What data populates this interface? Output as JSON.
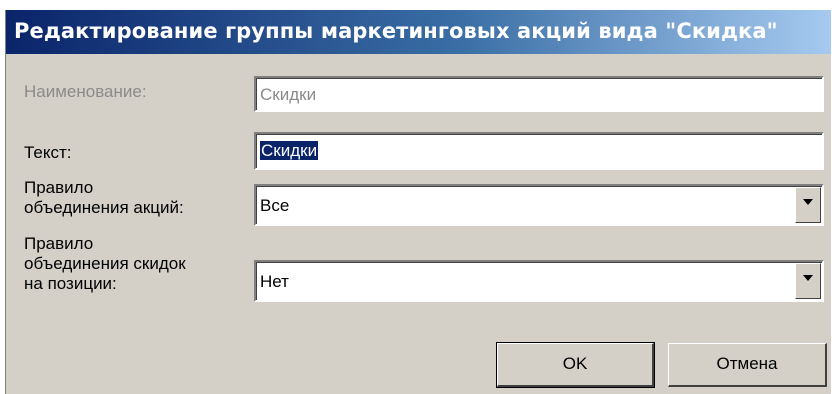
{
  "window": {
    "title": "Редактирование группы маркетинговых акций вида \"Скидка\""
  },
  "form": {
    "name_label": "Наименование:",
    "name_value": "Скидки",
    "text_label": "Текст:",
    "text_value": "Скидки",
    "promo_rule_label": "Правило\nобъединения акций:",
    "promo_rule_value": "Все",
    "discount_rule_label": "Правило\nобъединения скидок\nна позиции:",
    "discount_rule_value": "Нет"
  },
  "buttons": {
    "ok_label": "OK",
    "cancel_label": "Отмена"
  },
  "icons": {
    "dropdown": "chevron-down-icon"
  }
}
